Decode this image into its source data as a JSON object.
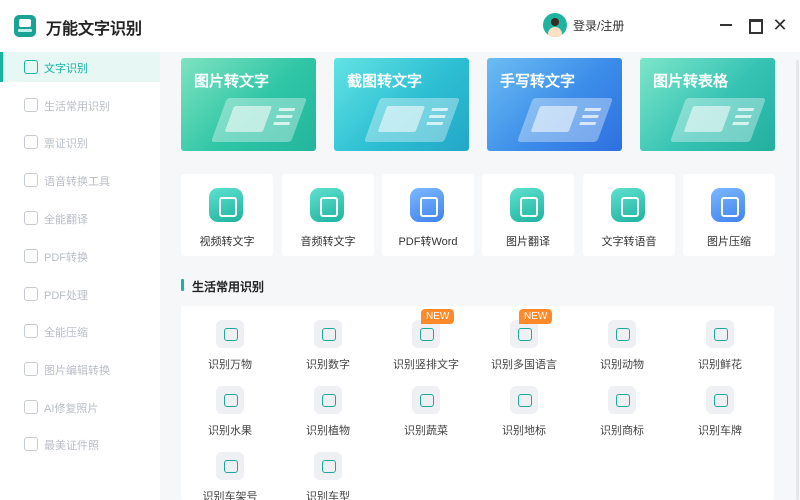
{
  "app": {
    "title": "万能文字识别"
  },
  "user": {
    "login_label": "登录/注册"
  },
  "window": {
    "close_glyph": "✕"
  },
  "sidebar": {
    "items": [
      {
        "label": "文字识别",
        "active": true
      },
      {
        "label": "生活常用识别",
        "active": false
      },
      {
        "label": "票证识别",
        "active": false
      },
      {
        "label": "语音转换工具",
        "active": false
      },
      {
        "label": "全能翻译",
        "active": false
      },
      {
        "label": "PDF转换",
        "active": false
      },
      {
        "label": "PDF处理",
        "active": false
      },
      {
        "label": "全能压缩",
        "active": false
      },
      {
        "label": "图片编辑转换",
        "active": false
      },
      {
        "label": "AI修复照片",
        "active": false
      },
      {
        "label": "最美证件照",
        "active": false
      }
    ]
  },
  "banners": [
    {
      "label": "图片转文字"
    },
    {
      "label": "截图转文字"
    },
    {
      "label": "手写转文字"
    },
    {
      "label": "图片转表格"
    }
  ],
  "tools": [
    {
      "label": "视频转文字",
      "icon": "video-icon"
    },
    {
      "label": "音频转文字",
      "icon": "audio-icon"
    },
    {
      "label": "PDF转Word",
      "icon": "pdf-word-icon"
    },
    {
      "label": "图片翻译",
      "icon": "image-translate-icon"
    },
    {
      "label": "文字转语音",
      "icon": "text-to-speech-icon"
    },
    {
      "label": "图片压缩",
      "icon": "image-compress-icon"
    }
  ],
  "life_section": {
    "title": "生活常用识别",
    "badge": "NEW",
    "items": [
      {
        "label": "识别万物",
        "icon": "eye-icon"
      },
      {
        "label": "识别数字",
        "icon": "digits-icon"
      },
      {
        "label": "识别竖排文字",
        "icon": "vertical-text-icon",
        "new": true
      },
      {
        "label": "识别多国语言",
        "icon": "multilang-icon",
        "new": true
      },
      {
        "label": "识别动物",
        "icon": "animal-icon"
      },
      {
        "label": "识别鲜花",
        "icon": "flower-icon"
      },
      {
        "label": "识别水果",
        "icon": "fruit-icon"
      },
      {
        "label": "识别植物",
        "icon": "plant-icon"
      },
      {
        "label": "识别蔬菜",
        "icon": "vegetable-icon"
      },
      {
        "label": "识别地标",
        "icon": "landmark-icon"
      },
      {
        "label": "识别商标",
        "icon": "trademark-icon"
      },
      {
        "label": "识别车牌",
        "icon": "car-plate-icon"
      },
      {
        "label": "识别车架号",
        "icon": "vin-icon"
      },
      {
        "label": "识别车型",
        "icon": "car-model-icon"
      }
    ]
  }
}
